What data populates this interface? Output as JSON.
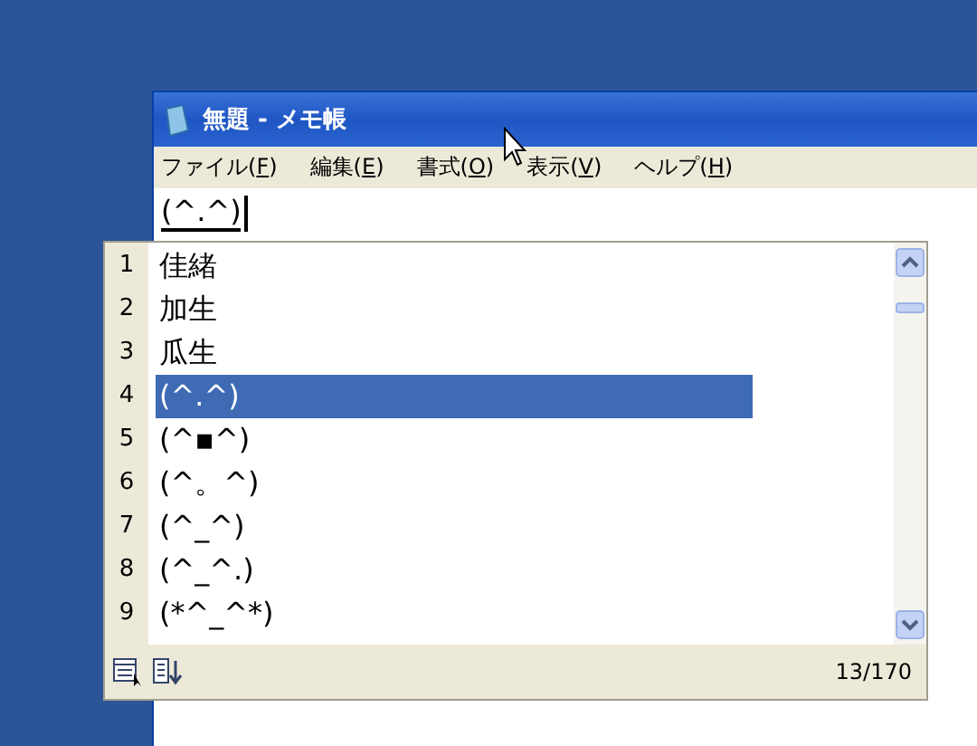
{
  "window": {
    "title": "無題 - メモ帳"
  },
  "menu": [
    {
      "label": "ファイル(",
      "key": "F",
      "tail": ")"
    },
    {
      "label": "編集(",
      "key": "E",
      "tail": ")"
    },
    {
      "label": "書式(",
      "key": "O",
      "tail": ")"
    },
    {
      "label": "表示(",
      "key": "V",
      "tail": ")"
    },
    {
      "label": "ヘルプ(",
      "key": "H",
      "tail": ")"
    }
  ],
  "editor": {
    "value": "(^.^)"
  },
  "candidates": [
    {
      "number": "1",
      "text": "佳緒",
      "selected": false
    },
    {
      "number": "2",
      "text": "加生",
      "selected": false
    },
    {
      "number": "3",
      "text": "瓜生",
      "selected": false
    },
    {
      "number": "4",
      "text": "(^.^)",
      "selected": true
    },
    {
      "number": "5",
      "text": "(^▪^)",
      "selected": false
    },
    {
      "number": "6",
      "text": "(^。^)",
      "selected": false
    },
    {
      "number": "7",
      "text": "(^_^)",
      "selected": false
    },
    {
      "number": "8",
      "text": "(^_^.)",
      "selected": false
    },
    {
      "number": "9",
      "text": "(*^_^*)",
      "selected": false
    }
  ],
  "candidate_count": "13/170"
}
